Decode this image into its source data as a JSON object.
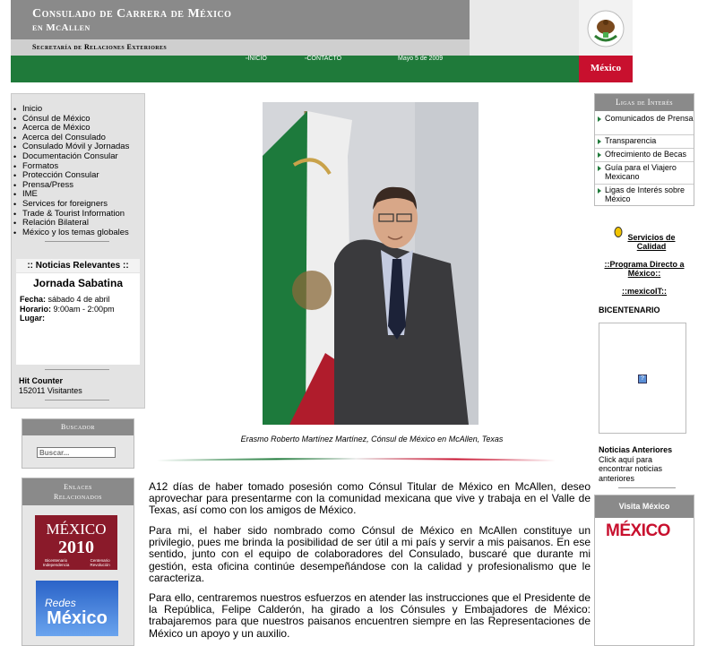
{
  "header": {
    "title": "Consulado de Carrera de México",
    "subtitle": "en McAllen",
    "secretaria": "Secretaría de Relaciones Exteriores",
    "seal_text": "ESTADOS UNIDOS MEXICANOS",
    "country_label": "México",
    "nav": [
      {
        "label": "INICIO"
      },
      {
        "label": "CONTACTO"
      }
    ],
    "date": "Mayo 5 de 2009"
  },
  "left_nav": {
    "items": [
      "Inicio",
      "Cónsul de México",
      "Acerca de México",
      "Acerca del Consulado",
      "Consulado Móvil y Jornadas",
      "Documentación Consular",
      "Formatos",
      "Protección Consular",
      "Prensa/Press",
      "IME",
      "Services for foreigners",
      "Trade & Tourist Information",
      "Relación Bilateral",
      "México y los temas globales"
    ]
  },
  "noticias": {
    "header": ":: Noticias Relevantes ::",
    "event_title": "Jornada Sabatina",
    "fecha_label": "Fecha:",
    "fecha_value": "sábado 4 de abril",
    "horario_label": "Horario:",
    "horario_value": "9:00am - 2:00pm",
    "lugar_label": "Lugar:"
  },
  "counter": {
    "label": "Hit Counter",
    "value": "152011 Visitantes"
  },
  "buscador": {
    "header": "Buscador",
    "placeholder": "Buscar..."
  },
  "enlaces": {
    "header_line1": "Enlaces",
    "header_line2": "Relacionados",
    "banner1_title": "MÉXICO",
    "banner1_year": "2010",
    "banner1_sub_left": "Bicentenario Independencia",
    "banner1_sub_right": "Centenario Revolución",
    "banner2_small": "Redes",
    "banner2_big": "México"
  },
  "main": {
    "caption": "Erasmo Roberto Martínez Martínez, Cónsul de México en McAllen, Texas",
    "paragraphs": [
      "A12 días de haber tomado posesión como Cónsul Titular de México en McAllen, deseo aprovechar para presentarme con la comunidad mexicana que vive y trabaja en el Valle de Texas, así como con los amigos de México.",
      "Para mi, el haber sido nombrado como Cónsul de México en McAllen constituye un privilegio, pues me brinda la posibilidad de ser útil a mi país y servir a mis paisanos. En ese sentido, junto con el equipo de colaboradores del Consulado, buscaré que durante mi gestión, esta oficina continúe desempeñándose con la calidad y profesionalismo que le caracteriza.",
      "Para ello, centraremos nuestros esfuerzos en atender las instrucciones que el Presidente de la República, Felipe Calderón, ha girado a los Cónsules y Embajadores de México: trabajaremos para que nuestros paisanos encuentren siempre en las Representaciones de México un apoyo y un auxilio."
    ]
  },
  "ligas": {
    "header": "Ligas de Interés",
    "items": [
      "Comunicados de Prensa",
      "Transparencia",
      "Ofrecimiento de Becas",
      "Guía para el Viajero Mexicano",
      "Ligas de Interés sobre México"
    ]
  },
  "right_links": {
    "servicios": "Servicios de Calidad",
    "programa": "::Programa Directo a México::",
    "mexicoit": "::mexicoIT::",
    "bicentenario": "BICENTENARIO",
    "broken_image": "?"
  },
  "noticias_anteriores": {
    "title": "Noticias Anteriores",
    "text": "Click aquí para encontrar noticias anteriores"
  },
  "visita": {
    "header": "Visita México",
    "logo": "MÉXICO"
  },
  "colors": {
    "green": "#1f7a3a",
    "red": "#c8102e",
    "gray": "#8a8a8a"
  }
}
